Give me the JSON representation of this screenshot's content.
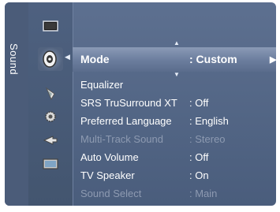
{
  "sidebar": {
    "title": "Sound"
  },
  "icons": [
    "picture-icon",
    "sound-icon",
    "channel-icon",
    "setup-icon",
    "input-icon",
    "application-icon"
  ],
  "menu": {
    "selected": {
      "label": "Mode",
      "value": ": Custom"
    },
    "items": [
      {
        "label": "Equalizer",
        "value": ""
      },
      {
        "label": "SRS TruSurround XT",
        "value": ": Off"
      },
      {
        "label": "Preferred Language",
        "value": ": English"
      },
      {
        "label": "Multi-Track Sound",
        "value": ": Stereo",
        "disabled": true
      },
      {
        "label": "Auto Volume",
        "value": ": Off"
      },
      {
        "label": "TV Speaker",
        "value": ": On"
      },
      {
        "label": "Sound Select",
        "value": ": Main",
        "disabled": true
      }
    ]
  },
  "colors": {
    "background": "#4a5d7c",
    "highlight": "#7d8eac",
    "text": "#ffffff",
    "disabled_text": "#8d9ab1"
  }
}
